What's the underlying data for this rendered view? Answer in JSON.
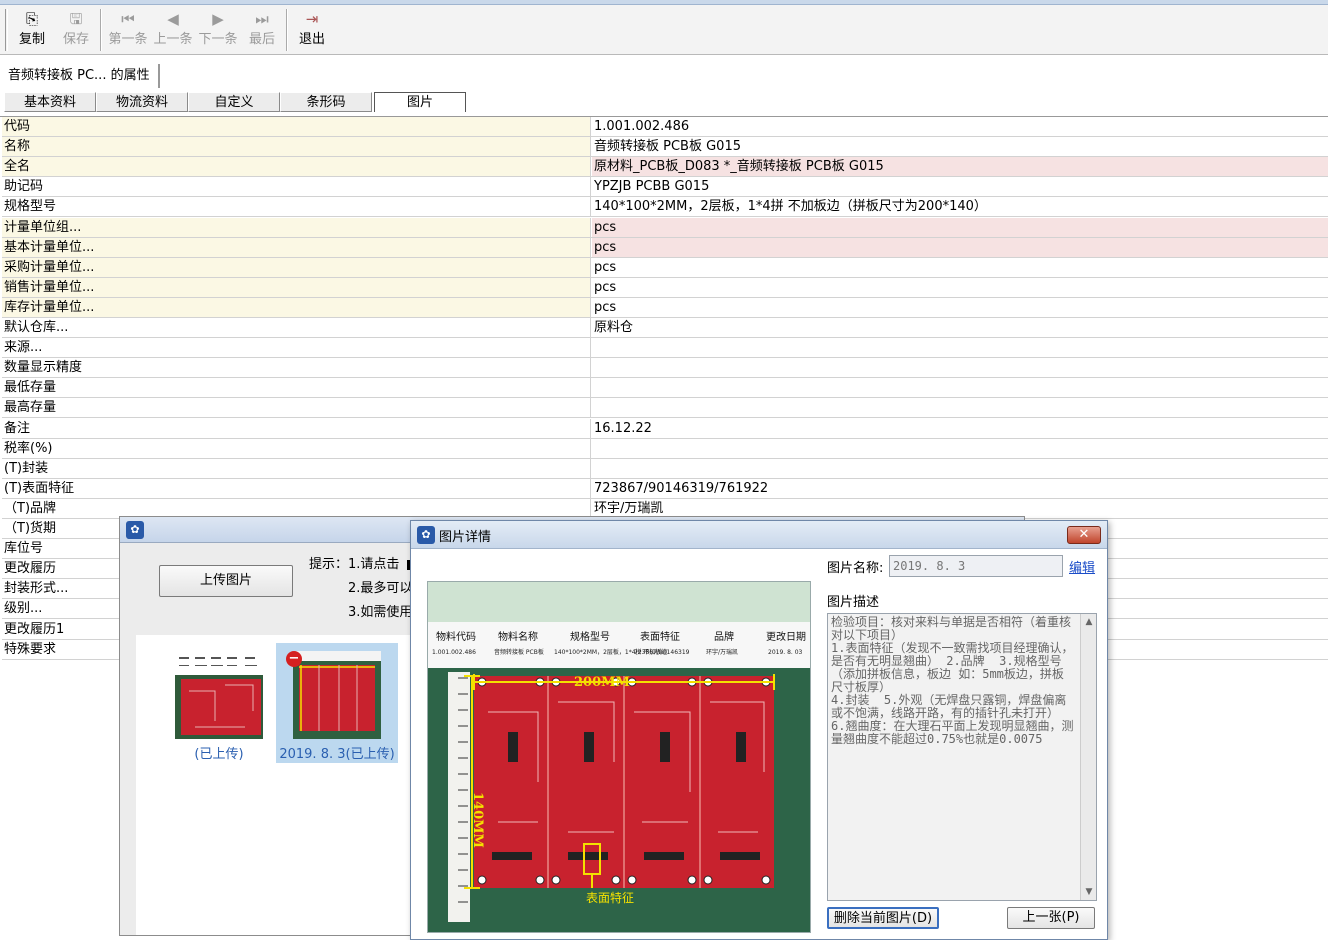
{
  "toolbar": {
    "copy": "复制",
    "save": "保存",
    "first": "第一条",
    "prev": "上一条",
    "next": "下一条",
    "last": "最后",
    "exit": "退出"
  },
  "prop_tab": "音频转接板 PC... 的属性",
  "tabs": [
    "基本资料",
    "物流资料",
    "自定义",
    "条形码",
    "图片"
  ],
  "grid": [
    {
      "k": "代码",
      "v": "1.001.002.486",
      "ky": true,
      "vp": false
    },
    {
      "k": "名称",
      "v": "音频转接板 PCB板   G015",
      "ky": true,
      "vp": false
    },
    {
      "k": "全名",
      "v": "原材料_PCB板_D083 *_音频转接板 PCB板   G015",
      "ky": true,
      "vp": true
    },
    {
      "k": "助记码",
      "v": "YPZJB PCBB   G015",
      "ky": false,
      "vp": false
    },
    {
      "k": "规格型号",
      "v": "140*100*2MM，2层板，1*4拼 不加板边（拼板尺寸为200*140）",
      "ky": false,
      "vp": false
    },
    {
      "k": "计量单位组...",
      "v": "pcs",
      "ky": true,
      "vp": true
    },
    {
      "k": "基本计量单位...",
      "v": "pcs",
      "ky": true,
      "vp": true
    },
    {
      "k": "采购计量单位...",
      "v": "pcs",
      "ky": true,
      "vp": false
    },
    {
      "k": "销售计量单位...",
      "v": "pcs",
      "ky": true,
      "vp": false
    },
    {
      "k": "库存计量单位...",
      "v": "pcs",
      "ky": true,
      "vp": false
    },
    {
      "k": "默认仓库...",
      "v": "原料仓",
      "ky": false,
      "vp": false
    },
    {
      "k": "来源...",
      "v": "",
      "ky": false,
      "vp": false
    },
    {
      "k": "数量显示精度",
      "v": "",
      "ky": false,
      "vp": false
    },
    {
      "k": "最低存量",
      "v": "",
      "ky": false,
      "vp": false
    },
    {
      "k": "最高存量",
      "v": "",
      "ky": false,
      "vp": false
    },
    {
      "k": "备注",
      "v": "16.12.22",
      "ky": false,
      "vp": false
    },
    {
      "k": "税率(%)",
      "v": "",
      "ky": false,
      "vp": false
    },
    {
      "k": "(T)封装",
      "v": "",
      "ky": false,
      "vp": false
    },
    {
      "k": "(T)表面特征",
      "v": "723867/90146319/761922",
      "ky": false,
      "vp": false
    },
    {
      "k": "（T)品牌",
      "v": "环宇/万瑞凯",
      "ky": false,
      "vp": false
    },
    {
      "k": "（T)货期",
      "v": "",
      "ky": false,
      "vp": false
    },
    {
      "k": "库位号",
      "v": "",
      "ky": false,
      "vp": false
    },
    {
      "k": "更改履历",
      "v": "",
      "ky": false,
      "vp": false
    },
    {
      "k": "封装形式...",
      "v": "",
      "ky": false,
      "vp": false
    },
    {
      "k": "级别...",
      "v": "",
      "ky": false,
      "vp": false
    },
    {
      "k": "更改履历1",
      "v": "",
      "ky": false,
      "vp": false
    },
    {
      "k": "特殊要求",
      "v": "",
      "ky": false,
      "vp": false
    }
  ],
  "upload": {
    "button": "上传图片",
    "hint1": "提示：1.请点击",
    "hint2": "2.最多可以",
    "hint3": "3.如需使用",
    "thumb1_caption": "(已上传)",
    "thumb2_caption": "2019. 8. 3(已上传)"
  },
  "detail": {
    "title": "图片详情",
    "close": "✕",
    "name_label": "图片名称:",
    "name_value": "2019. 8. 3",
    "edit": "编辑",
    "desc_label": "图片描述",
    "desc_text": "检验项目：核对来料与单据是否相符（着重核对以下项目）\n1.表面特征（发现不一致需找项目经理确认，是否有无明显翘曲） 2.品牌  3.规格型号（添加拼板信息，板边 如：5mm板边，拼板尺寸板厚）\n4.封装  5.外观（无焊盘只露铜，焊盘偏离或不饱满，线路开路，有的插针孔未打开）\n6.翘曲度：在大理石平面上发现明显翘曲，测量翘曲度不能超过0.75%也就是0.0075",
    "delete_btn": "删除当前图片(D)",
    "prev_btn": "上一张(P)",
    "photo": {
      "headers": [
        "物料代码",
        "物料名称",
        "规格型号",
        "表面特征",
        "品牌",
        "更改日期"
      ],
      "cells": [
        "1.001.002.486",
        "音频转接板 PCB板",
        "140*100*2MM，2层板，1*4拼 不加板边",
        "723867/90146319",
        "环宇/万瑞凯",
        "2019. 8. 03"
      ],
      "dim_h": "200MM",
      "dim_v": "140MM",
      "feature": "表面特征"
    }
  },
  "colors": {
    "key_yellow": "#fbf8e4",
    "val_pink": "#f6e2e2",
    "pcb_red": "#c8222e",
    "dim_yellow": "#f4e100"
  }
}
